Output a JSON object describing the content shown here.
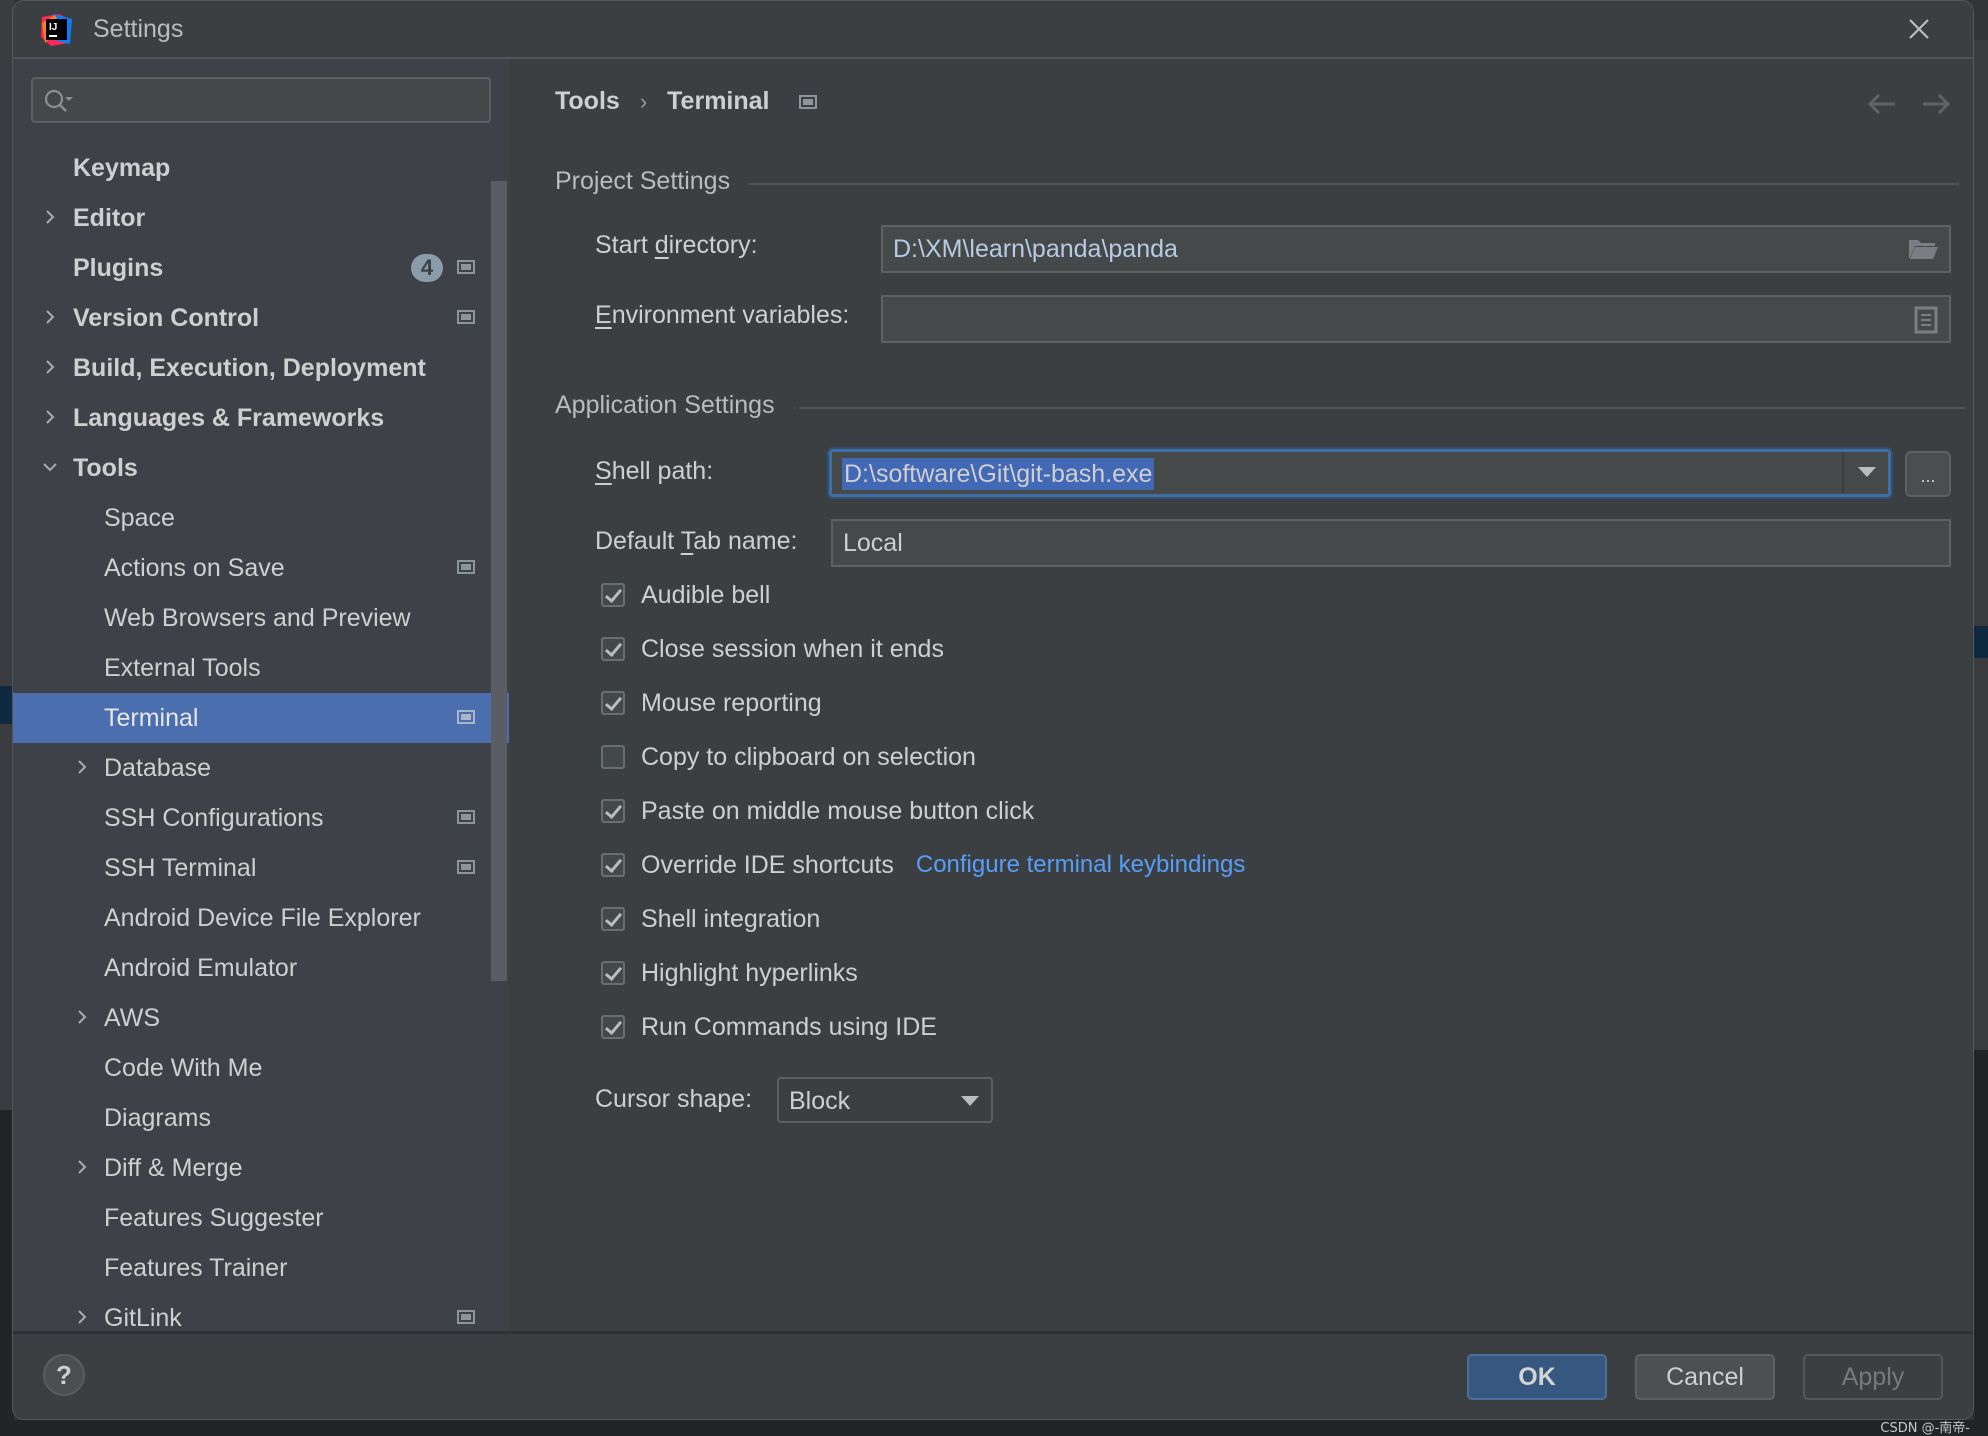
{
  "window": {
    "title": "Settings",
    "logo_text": "IJ"
  },
  "search": {
    "placeholder": "",
    "value": ""
  },
  "sidebar": {
    "items": [
      {
        "label": "Keymap",
        "level": 0,
        "bold": true,
        "expander": "none",
        "badge": null,
        "project_icon": false,
        "selected": false
      },
      {
        "label": "Editor",
        "level": 0,
        "bold": true,
        "expander": "collapsed",
        "badge": null,
        "project_icon": false,
        "selected": false
      },
      {
        "label": "Plugins",
        "level": 0,
        "bold": true,
        "expander": "none",
        "badge": "4",
        "project_icon": true,
        "selected": false
      },
      {
        "label": "Version Control",
        "level": 0,
        "bold": true,
        "expander": "collapsed",
        "badge": null,
        "project_icon": true,
        "selected": false
      },
      {
        "label": "Build, Execution, Deployment",
        "level": 0,
        "bold": true,
        "expander": "collapsed",
        "badge": null,
        "project_icon": false,
        "selected": false
      },
      {
        "label": "Languages & Frameworks",
        "level": 0,
        "bold": true,
        "expander": "collapsed",
        "badge": null,
        "project_icon": false,
        "selected": false
      },
      {
        "label": "Tools",
        "level": 0,
        "bold": true,
        "expander": "expanded",
        "badge": null,
        "project_icon": false,
        "selected": false
      },
      {
        "label": "Space",
        "level": 1,
        "bold": false,
        "expander": "none",
        "badge": null,
        "project_icon": false,
        "selected": false
      },
      {
        "label": "Actions on Save",
        "level": 1,
        "bold": false,
        "expander": "none",
        "badge": null,
        "project_icon": true,
        "selected": false
      },
      {
        "label": "Web Browsers and Preview",
        "level": 1,
        "bold": false,
        "expander": "none",
        "badge": null,
        "project_icon": false,
        "selected": false
      },
      {
        "label": "External Tools",
        "level": 1,
        "bold": false,
        "expander": "none",
        "badge": null,
        "project_icon": false,
        "selected": false
      },
      {
        "label": "Terminal",
        "level": 1,
        "bold": false,
        "expander": "none",
        "badge": null,
        "project_icon": true,
        "selected": true
      },
      {
        "label": "Database",
        "level": 1,
        "bold": false,
        "expander": "collapsed",
        "badge": null,
        "project_icon": false,
        "selected": false
      },
      {
        "label": "SSH Configurations",
        "level": 1,
        "bold": false,
        "expander": "none",
        "badge": null,
        "project_icon": true,
        "selected": false
      },
      {
        "label": "SSH Terminal",
        "level": 1,
        "bold": false,
        "expander": "none",
        "badge": null,
        "project_icon": true,
        "selected": false
      },
      {
        "label": "Android Device File Explorer",
        "level": 1,
        "bold": false,
        "expander": "none",
        "badge": null,
        "project_icon": false,
        "selected": false
      },
      {
        "label": "Android Emulator",
        "level": 1,
        "bold": false,
        "expander": "none",
        "badge": null,
        "project_icon": false,
        "selected": false
      },
      {
        "label": "AWS",
        "level": 1,
        "bold": false,
        "expander": "collapsed",
        "badge": null,
        "project_icon": false,
        "selected": false
      },
      {
        "label": "Code With Me",
        "level": 1,
        "bold": false,
        "expander": "none",
        "badge": null,
        "project_icon": false,
        "selected": false
      },
      {
        "label": "Diagrams",
        "level": 1,
        "bold": false,
        "expander": "none",
        "badge": null,
        "project_icon": false,
        "selected": false
      },
      {
        "label": "Diff & Merge",
        "level": 1,
        "bold": false,
        "expander": "collapsed",
        "badge": null,
        "project_icon": false,
        "selected": false
      },
      {
        "label": "Features Suggester",
        "level": 1,
        "bold": false,
        "expander": "none",
        "badge": null,
        "project_icon": false,
        "selected": false
      },
      {
        "label": "Features Trainer",
        "level": 1,
        "bold": false,
        "expander": "none",
        "badge": null,
        "project_icon": false,
        "selected": false
      },
      {
        "label": "GitLink",
        "level": 1,
        "bold": false,
        "expander": "collapsed",
        "badge": null,
        "project_icon": true,
        "selected": false
      }
    ]
  },
  "breadcrumb": {
    "parent": "Tools",
    "separator": "›",
    "current": "Terminal"
  },
  "project_settings": {
    "title": "Project Settings",
    "start_directory": {
      "label_pre": "Start ",
      "label_mnemonic": "d",
      "label_post": "irectory:",
      "value": "D:\\XM\\learn\\panda\\panda"
    },
    "environment_variables": {
      "label_mnemonic": "E",
      "label_post": "nvironment variables:",
      "value": ""
    }
  },
  "application_settings": {
    "title": "Application Settings",
    "shell_path": {
      "label_mnemonic": "S",
      "label_post": "hell path:",
      "value": "D:\\software\\Git\\git-bash.exe",
      "browse_label": "..."
    },
    "default_tab_name": {
      "label_pre": "Default ",
      "label_mnemonic": "T",
      "label_post": "ab name:",
      "value": "Local"
    },
    "checkboxes": [
      {
        "label": "Audible bell",
        "checked": true
      },
      {
        "label": "Close session when it ends",
        "checked": true
      },
      {
        "label": "Mouse reporting",
        "checked": true
      },
      {
        "label": "Copy to clipboard on selection",
        "checked": false
      },
      {
        "label": "Paste on middle mouse button click",
        "checked": true
      },
      {
        "label": "Override IDE shortcuts",
        "checked": true,
        "link": "Configure terminal keybindings"
      },
      {
        "label": "Shell integration",
        "checked": true
      },
      {
        "label": "Highlight hyperlinks",
        "checked": true
      },
      {
        "label": "Run Commands using IDE",
        "checked": true
      }
    ],
    "cursor_shape": {
      "label": "Cursor shape:",
      "value": "Block"
    }
  },
  "footer": {
    "help_label": "?",
    "ok_label": "OK",
    "cancel_label": "Cancel",
    "apply_label": "Apply",
    "apply_enabled": false
  },
  "watermark": "CSDN @-南帝-",
  "colors": {
    "selection": "#4b6eaf",
    "link": "#589df6",
    "ok_button": "#365880",
    "focus_ring": "#3d6ea5"
  }
}
